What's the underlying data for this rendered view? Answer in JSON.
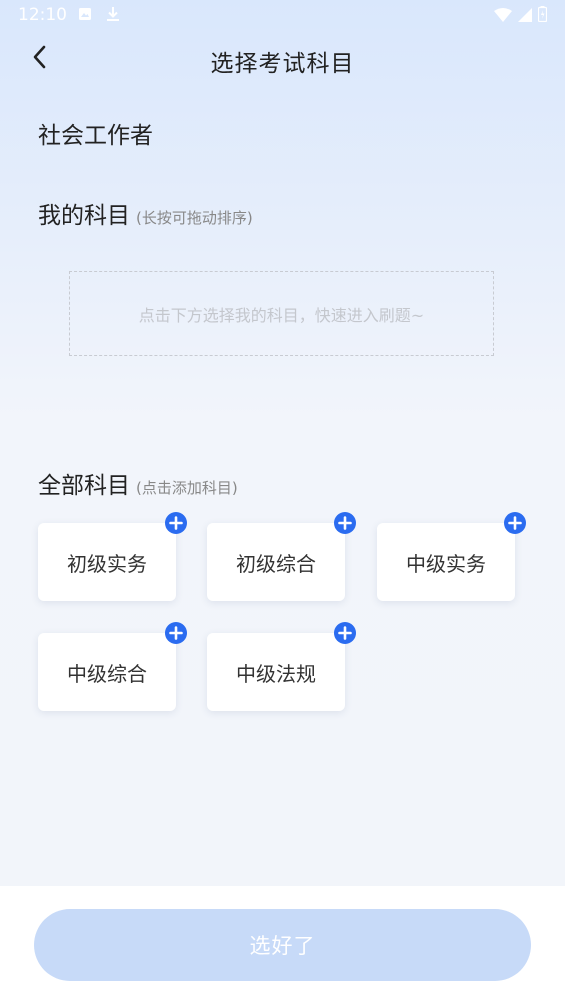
{
  "status_bar": {
    "time": "12:10",
    "left_icons": [
      "photo-icon",
      "download-icon"
    ],
    "right_icons": [
      "wifi-icon",
      "signal-icon",
      "battery-icon"
    ]
  },
  "header": {
    "back_icon": "chevron-left-icon",
    "title": "选择考试科目"
  },
  "career": "社会工作者",
  "my_subjects": {
    "title": "我的科目",
    "hint": "(长按可拖动排序)",
    "empty_text": "点击下方选择我的科目，快速进入刷题~"
  },
  "all_subjects": {
    "title": "全部科目",
    "hint": "(点击添加科目)",
    "items": [
      {
        "label": "初级实务",
        "icon": "add-circle-icon"
      },
      {
        "label": "初级综合",
        "icon": "add-circle-icon"
      },
      {
        "label": "中级实务",
        "icon": "add-circle-icon"
      },
      {
        "label": "中级综合",
        "icon": "add-circle-icon"
      },
      {
        "label": "中级法规",
        "icon": "add-circle-icon"
      }
    ]
  },
  "confirm_button": {
    "label": "选好了"
  },
  "colors": {
    "accent": "#2b6cf0",
    "button_disabled": "#c7daf8",
    "background_top": "#d9e7fc",
    "background": "#f2f5fa"
  }
}
